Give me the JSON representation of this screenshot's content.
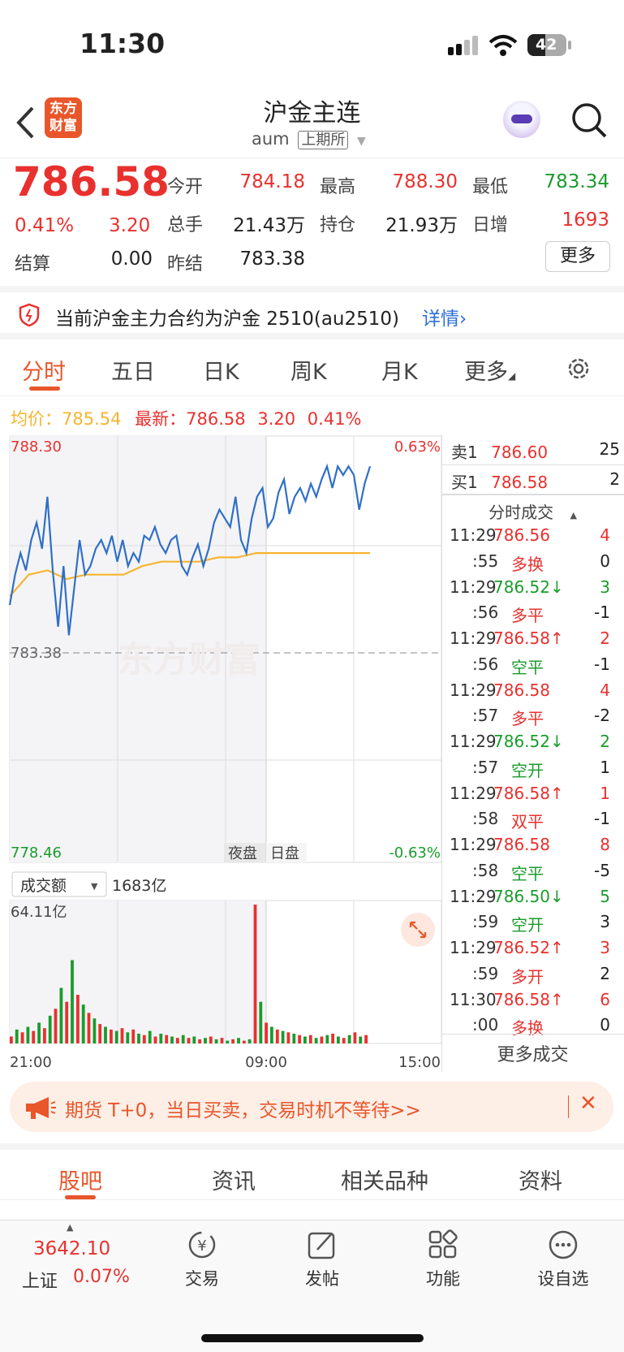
{
  "status_bar": {
    "time": "11:30",
    "battery": "42"
  },
  "header": {
    "title": "沪金主连",
    "code": "aum",
    "exchange": "上期所",
    "logo_line1": "东方",
    "logo_line2": "财富"
  },
  "quote": {
    "price": "786.58",
    "change_pct": "0.41%",
    "change": "3.20",
    "settle_label": "结算",
    "settle": "0.00",
    "prev_settle_label": "昨结",
    "prev_settle": "783.38",
    "open_label": "今开",
    "open": "784.18",
    "high_label": "最高",
    "high": "788.30",
    "low_label": "最低",
    "low": "783.34",
    "volume_label": "总手",
    "volume": "21.43万",
    "oi_label": "持仓",
    "oi": "21.93万",
    "daily_inc_label": "日增",
    "daily_inc": "1693",
    "more_label": "更多"
  },
  "notice": {
    "text": "当前沪金主力合约为沪金 2510(au2510)",
    "link": "详情"
  },
  "tabs": {
    "t0": "分时",
    "t1": "五日",
    "t2": "日K",
    "t3": "周K",
    "t4": "月K",
    "t5": "更多"
  },
  "chart_header": {
    "avg_label": "均价：",
    "avg": "785.54",
    "latest_label": "最新：",
    "latest": "786.58",
    "chg": "3.20",
    "pct": "0.41%"
  },
  "chart_labels": {
    "ymax": "788.30",
    "ymin": "778.46",
    "ref": "783.38",
    "pct_max": "0.63%",
    "pct_min": "-0.63%",
    "night": "夜盘",
    "day": "日盘",
    "vol_selector": "成交额",
    "vol_total": "1683亿",
    "vol_max": "64.11亿",
    "x0": "21:00",
    "x1": "09:00",
    "x2": "15:00",
    "watermark": "东方财富"
  },
  "chart_data": [
    {
      "type": "line",
      "title": "",
      "xlabel": "",
      "ylabel": "",
      "x_labels": [
        "21:00",
        "09:00",
        "15:00"
      ],
      "ylim": [
        778.46,
        788.3
      ],
      "reference": 783.38,
      "series": [
        {
          "values": [
            784.4,
            785.1,
            785.6,
            785.2,
            785.9,
            786.3,
            785.7,
            786.9,
            785.2,
            783.9,
            785.3,
            783.7,
            784.8,
            785.9,
            785.1,
            785.3,
            785.7,
            785.9,
            785.6,
            786.0,
            785.4,
            785.9,
            785.3,
            785.6,
            785.4,
            786.0,
            785.9,
            786.2,
            785.8,
            785.6,
            785.9,
            786.0,
            785.3,
            785.1,
            785.5,
            785.8,
            785.3,
            785.7,
            786.3,
            786.6,
            786.4,
            786.2,
            786.9,
            785.9,
            785.6,
            786.4,
            786.9,
            787.1,
            786.2,
            786.4,
            787.0,
            787.3,
            786.5,
            786.9,
            787.1,
            786.8,
            787.2,
            786.9,
            787.3,
            787.6,
            787.1,
            787.6,
            787.4,
            787.6,
            787.4,
            786.6,
            787.2,
            787.6
          ]
        },
        {
          "values": [
            784.6,
            785.1,
            785.2,
            785.0,
            785.1,
            785.1,
            785.1,
            785.3,
            785.4,
            785.4,
            785.4,
            785.5,
            785.5,
            785.6,
            785.6,
            785.6,
            785.6,
            785.6,
            785.6,
            785.6
          ]
        }
      ]
    },
    {
      "type": "bar",
      "title": "",
      "ylabel": "",
      "ymax_label": "64.11亿",
      "values": [
        5,
        10,
        8,
        12,
        9,
        15,
        11,
        20,
        25,
        40,
        30,
        60,
        35,
        28,
        22,
        18,
        14,
        12,
        10,
        9,
        11,
        8,
        10,
        7,
        6,
        9,
        5,
        7,
        6,
        5,
        4,
        6,
        4,
        5,
        3,
        4,
        5,
        3,
        4,
        2,
        3,
        4,
        2,
        3,
        100,
        30,
        15,
        12,
        10,
        9,
        8,
        7,
        6,
        5,
        6,
        4,
        5,
        6,
        7,
        5,
        4,
        6,
        8,
        5,
        6
      ]
    }
  ],
  "order_book": {
    "sell_label": "卖1",
    "sell_price": "786.60",
    "sell_vol": "25",
    "buy_label": "买1",
    "buy_price": "786.58",
    "buy_vol": "2"
  },
  "trades_title": "分时成交",
  "trades": [
    {
      "time": "11:29",
      "price": "786.56",
      "vol": "4",
      "sub": ":55",
      "type": "多换",
      "delta": "0"
    },
    {
      "time": "11:29",
      "price": "786.52↓",
      "vol": "3",
      "sub": ":56",
      "type": "多平",
      "delta": "-1"
    },
    {
      "time": "11:29",
      "price": "786.58↑",
      "vol": "2",
      "sub": ":56",
      "type": "空平",
      "delta": "-1"
    },
    {
      "time": "11:29",
      "price": "786.58",
      "vol": "4",
      "sub": ":57",
      "type": "多平",
      "delta": "-2"
    },
    {
      "time": "11:29",
      "price": "786.52↓",
      "vol": "2",
      "sub": ":57",
      "type": "空开",
      "delta": "1"
    },
    {
      "time": "11:29",
      "price": "786.58↑",
      "vol": "1",
      "sub": ":58",
      "type": "双平",
      "delta": "-1"
    },
    {
      "time": "11:29",
      "price": "786.58",
      "vol": "8",
      "sub": ":58",
      "type": "空平",
      "delta": "-5"
    },
    {
      "time": "11:29",
      "price": "786.50↓",
      "vol": "5",
      "sub": ":59",
      "type": "空开",
      "delta": "3"
    },
    {
      "time": "11:29",
      "price": "786.52↑",
      "vol": "3",
      "sub": ":59",
      "type": "多开",
      "delta": "2"
    },
    {
      "time": "11:30",
      "price": "786.58↑",
      "vol": "6",
      "sub": ":00",
      "type": "多换",
      "delta": "0"
    }
  ],
  "trades_more": "更多成交",
  "promo": {
    "text": "期货 T+0，当日买卖，交易时机不等待>>"
  },
  "bottom_tabs": {
    "t0": "股吧",
    "t1": "资讯",
    "t2": "相关品种",
    "t3": "资料"
  },
  "bottom_nav": {
    "index_value": "3642.10",
    "index_name": "上证",
    "index_pct": "0.07%",
    "trade": "交易",
    "post": "发帖",
    "func": "功能",
    "watch": "设自选"
  },
  "colors": {
    "up": "#e8312e",
    "down": "#1a9c2c",
    "accent": "#e8562a",
    "link": "#2f6fd8",
    "avg_line": "#f5b530",
    "price_line": "#2f6fc7"
  }
}
